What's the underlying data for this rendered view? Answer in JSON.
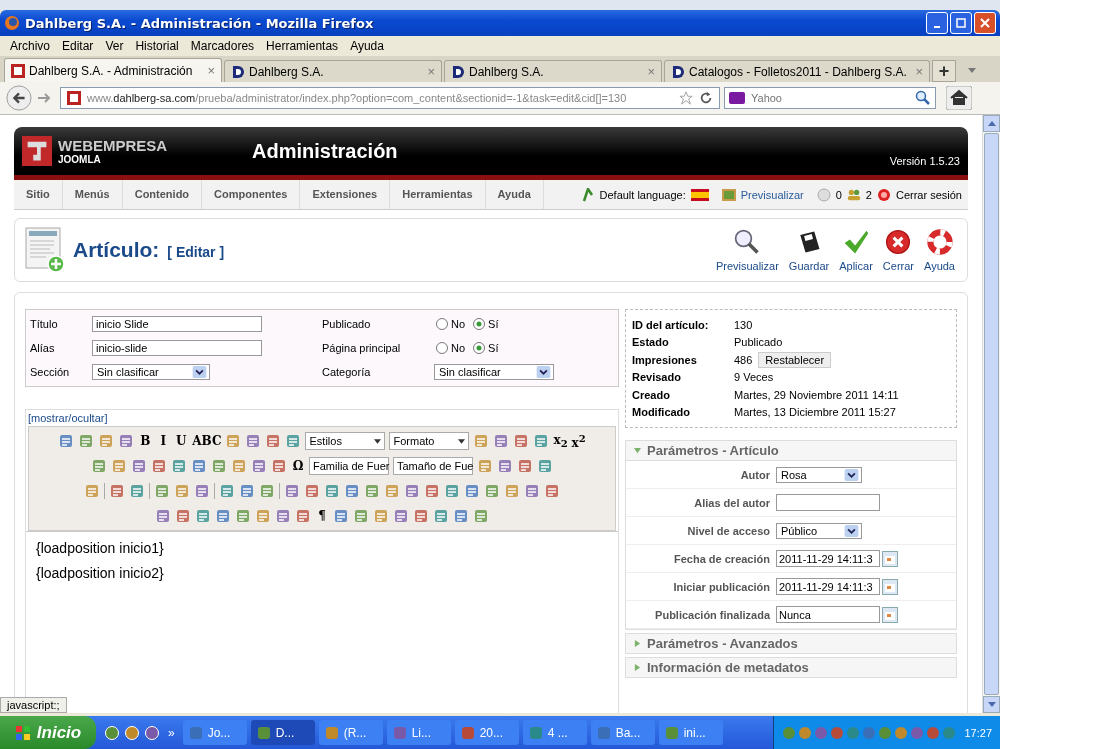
{
  "browser": {
    "title": "Dahlberg S.A. - Administración - Mozilla Firefox",
    "menu": [
      "Archivo",
      "Editar",
      "Ver",
      "Historial",
      "Marcadores",
      "Herramientas",
      "Ayuda"
    ],
    "tabs": [
      {
        "label": "Dahlberg S.A. - Administración",
        "close": "×",
        "selected": true
      },
      {
        "label": "Dahlberg S.A.",
        "close": "×",
        "selected": false
      },
      {
        "label": "Dahlberg S.A.",
        "close": "×",
        "selected": false
      },
      {
        "label": "Catalogos - Folletos2011 - Dahlberg S.A.",
        "close": "×",
        "selected": false
      }
    ],
    "new_tab": "+",
    "url": {
      "prefix": "www.",
      "domain": "dahlberg-sa.com",
      "path": "/prueba/administrator/index.php?option=com_content&sectionid=-1&task=edit&cid[]=130"
    },
    "search": {
      "placeholder": "Yahoo"
    },
    "status": "javascript:;"
  },
  "joomla": {
    "brand": "WEBEMPRESA",
    "sub": "JOOMLA",
    "title": "Administración",
    "version": "Versión 1.5.23",
    "menu": [
      "Sitio",
      "Menús",
      "Contenido",
      "Componentes",
      "Extensiones",
      "Herramientas",
      "Ayuda"
    ],
    "language_label": "Default language:",
    "preview": "Previsualizar",
    "messages": "0",
    "users": "2",
    "logout": "Cerrar sesión"
  },
  "page": {
    "title": "Artículo:",
    "subtitle": "[ Editar ]",
    "actions": [
      {
        "label": "Previsualizar",
        "kind": "preview"
      },
      {
        "label": "Guardar",
        "kind": "save"
      },
      {
        "label": "Aplicar",
        "kind": "apply"
      },
      {
        "label": "Cerrar",
        "kind": "close"
      },
      {
        "label": "Ayuda",
        "kind": "help"
      }
    ]
  },
  "form": {
    "left": [
      {
        "label": "Título",
        "kind": "text",
        "value": "inicio Slide"
      },
      {
        "label": "Alías",
        "kind": "text",
        "value": "inicio-slide"
      },
      {
        "label": "Sección",
        "kind": "select",
        "value": "Sin clasificar"
      }
    ],
    "right": [
      {
        "label": "Publicado",
        "kind": "radio",
        "options": [
          {
            "label": "No",
            "selected": false
          },
          {
            "label": "Sí",
            "selected": true
          }
        ]
      },
      {
        "label": "Página principal",
        "kind": "radio",
        "options": [
          {
            "label": "No",
            "selected": false
          },
          {
            "label": "Sí",
            "selected": true
          }
        ]
      },
      {
        "label": "Categoría",
        "kind": "select",
        "value": "Sin clasificar"
      }
    ]
  },
  "editor": {
    "toggle": "[mostrar/ocultar]",
    "rows": [
      {
        "items": [
          {
            "kind": "icon"
          },
          {
            "kind": "icon"
          },
          {
            "kind": "icon"
          },
          {
            "kind": "icon"
          },
          {
            "kind": "glyph",
            "text": "B"
          },
          {
            "kind": "glyph",
            "text": "I"
          },
          {
            "kind": "glyph",
            "text": "U"
          },
          {
            "kind": "glyph",
            "text": "ABC"
          },
          {
            "kind": "icon"
          },
          {
            "kind": "icon"
          },
          {
            "kind": "icon"
          },
          {
            "kind": "icon"
          },
          {
            "kind": "select",
            "text": "Estilos"
          },
          {
            "kind": "select",
            "text": "Formato"
          },
          {
            "kind": "icon"
          },
          {
            "kind": "icon"
          },
          {
            "kind": "icon"
          },
          {
            "kind": "icon"
          },
          {
            "kind": "glyph",
            "text": "x$_{2}$"
          },
          {
            "kind": "glyph",
            "text": "x$^{2}$"
          }
        ]
      },
      {
        "items": [
          {
            "kind": "icon"
          },
          {
            "kind": "icon"
          },
          {
            "kind": "icon"
          },
          {
            "kind": "icon"
          },
          {
            "kind": "icon"
          },
          {
            "kind": "icon"
          },
          {
            "kind": "icon"
          },
          {
            "kind": "icon"
          },
          {
            "kind": "icon"
          },
          {
            "kind": "icon"
          },
          {
            "kind": "glyph",
            "text": "Ω"
          },
          {
            "kind": "select",
            "text": "Familia de Fuer"
          },
          {
            "kind": "select",
            "text": "Tamaño de Fue"
          },
          {
            "kind": "icon"
          },
          {
            "kind": "icon"
          },
          {
            "kind": "icon"
          },
          {
            "kind": "icon"
          }
        ]
      },
      {
        "items": [
          {
            "kind": "icon"
          },
          {
            "kind": "sep"
          },
          {
            "kind": "icon"
          },
          {
            "kind": "icon"
          },
          {
            "kind": "sep"
          },
          {
            "kind": "icon"
          },
          {
            "kind": "icon"
          },
          {
            "kind": "icon"
          },
          {
            "kind": "sep"
          },
          {
            "kind": "icon"
          },
          {
            "kind": "icon"
          },
          {
            "kind": "icon"
          },
          {
            "kind": "sep"
          },
          {
            "kind": "icon"
          },
          {
            "kind": "icon"
          },
          {
            "kind": "icon"
          },
          {
            "kind": "icon"
          },
          {
            "kind": "icon"
          },
          {
            "kind": "icon"
          },
          {
            "kind": "icon"
          },
          {
            "kind": "icon"
          },
          {
            "kind": "icon"
          },
          {
            "kind": "icon"
          },
          {
            "kind": "icon"
          },
          {
            "kind": "icon"
          },
          {
            "kind": "icon"
          },
          {
            "kind": "icon"
          }
        ]
      },
      {
        "items": [
          {
            "kind": "icon"
          },
          {
            "kind": "icon"
          },
          {
            "kind": "icon"
          },
          {
            "kind": "icon"
          },
          {
            "kind": "icon"
          },
          {
            "kind": "icon"
          },
          {
            "kind": "icon"
          },
          {
            "kind": "icon"
          },
          {
            "kind": "glyph",
            "text": "¶"
          },
          {
            "kind": "icon"
          },
          {
            "kind": "icon"
          },
          {
            "kind": "icon"
          },
          {
            "kind": "icon"
          },
          {
            "kind": "icon"
          },
          {
            "kind": "icon"
          },
          {
            "kind": "icon"
          },
          {
            "kind": "icon"
          }
        ]
      }
    ],
    "content": [
      "{loadposition inicio1}",
      "{loadposition inicio2}"
    ]
  },
  "info": [
    {
      "label": "ID del artículo:",
      "value": "130"
    },
    {
      "label": "Estado",
      "value": "Publicado"
    },
    {
      "label": "Impresiones",
      "value": "486",
      "button": "Restablecer"
    },
    {
      "label": "Revisado",
      "value": "9 Veces"
    },
    {
      "label": "Creado",
      "value": "Martes, 29 Noviembre 2011 14:11"
    },
    {
      "label": "Modificado",
      "value": "Martes, 13 Diciembre 2011 15:27"
    }
  ],
  "panels": [
    {
      "title": "Parámetros - Artículo",
      "expanded": true,
      "fields": [
        {
          "label": "Autor",
          "kind": "select",
          "value": "Rosa"
        },
        {
          "label": "Alias del autor",
          "kind": "text"
        },
        {
          "label": "Nivel de acceso",
          "kind": "select",
          "value": "Público"
        },
        {
          "label": "Fecha de creación",
          "kind": "date",
          "value": "2011-11-29 14:11:3"
        },
        {
          "label": "Iniciar publicación",
          "kind": "date",
          "value": "2011-11-29 14:11:3"
        },
        {
          "label": "Publicación finalizada",
          "kind": "date",
          "value": "Nunca"
        }
      ]
    },
    {
      "title": "Parámetros - Avanzados",
      "expanded": false
    },
    {
      "title": "Información de metadatos",
      "expanded": false
    }
  ],
  "taskbar": {
    "start": "Inicio",
    "chevron": "»",
    "items": [
      {
        "label": "Jo...",
        "selected": false
      },
      {
        "label": "D...",
        "selected": true
      },
      {
        "label": "(R...",
        "selected": false
      },
      {
        "label": "Li...",
        "selected": false
      },
      {
        "label": "20...",
        "selected": false
      },
      {
        "label": "4 ...",
        "selected": false
      },
      {
        "label": "Ba...",
        "selected": false
      },
      {
        "label": "ini...",
        "selected": false
      }
    ],
    "clock": "17:27"
  }
}
